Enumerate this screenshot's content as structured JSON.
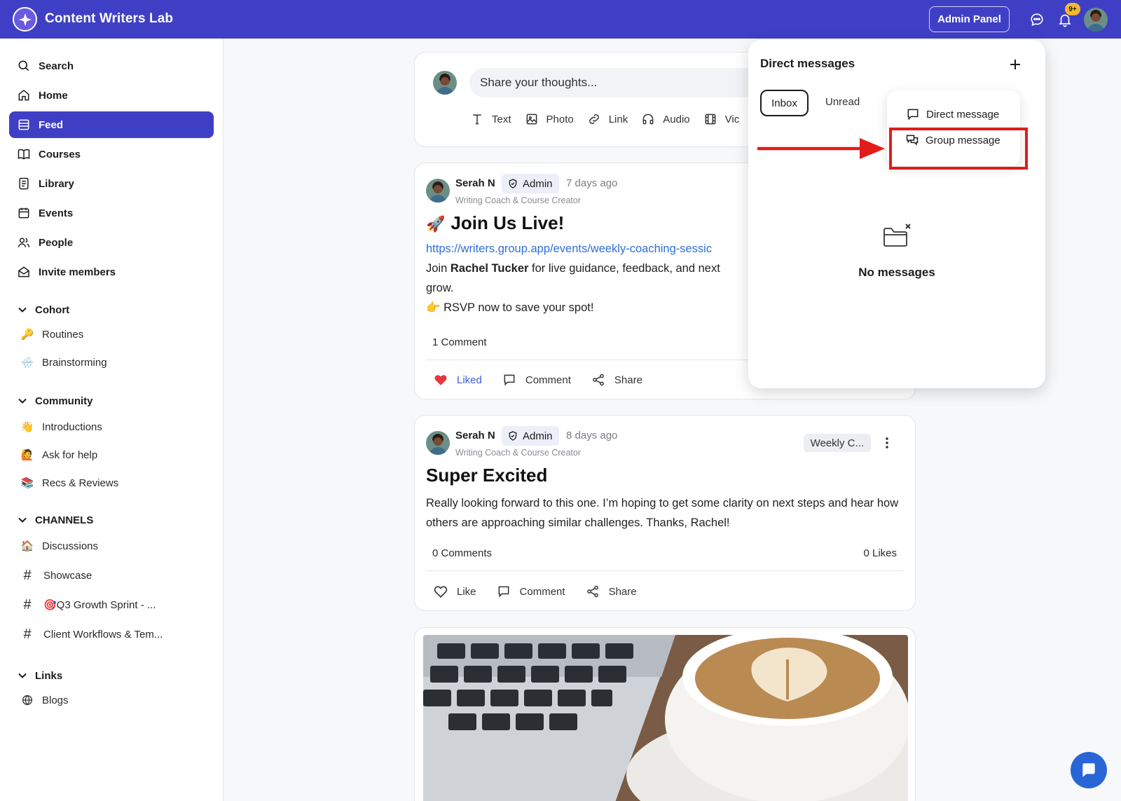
{
  "header": {
    "app_name": "Content Writers Lab",
    "admin_label": "Admin Panel",
    "notification_count": "9+",
    "accent": "#3f3fc6"
  },
  "sidebar": {
    "nav": [
      {
        "label": "Search",
        "icon": "search-icon"
      },
      {
        "label": "Home",
        "icon": "home-icon"
      },
      {
        "label": "Feed",
        "icon": "feed-icon",
        "active": true
      },
      {
        "label": "Courses",
        "icon": "book-icon"
      },
      {
        "label": "Library",
        "icon": "library-icon"
      },
      {
        "label": "Events",
        "icon": "calendar-icon"
      },
      {
        "label": "People",
        "icon": "people-icon"
      },
      {
        "label": "Invite members",
        "icon": "envelope-icon"
      }
    ],
    "sections": {
      "cohort": {
        "title": "Cohort",
        "items": [
          {
            "emoji": "🔑",
            "label": "Routines"
          },
          {
            "emoji": "🌧️",
            "label": "Brainstorming"
          }
        ]
      },
      "community": {
        "title": "Community",
        "items": [
          {
            "emoji": "👋",
            "label": "Introductions"
          },
          {
            "emoji": "🙋",
            "label": "Ask for help"
          },
          {
            "emoji": "📚",
            "label": "Recs & Reviews"
          }
        ]
      },
      "channels": {
        "title": "CHANNELS",
        "items": [
          {
            "emoji": "🏠",
            "label": "Discussions"
          },
          {
            "label": "Showcase"
          },
          {
            "label": "🎯Q3 Growth Sprint - ..."
          },
          {
            "label": "Client Workflows & Tem..."
          }
        ]
      },
      "links": {
        "title": "Links",
        "items": [
          {
            "label": "Blogs",
            "icon": "globe-icon"
          }
        ]
      }
    }
  },
  "composer": {
    "placeholder": "Share your thoughts...",
    "tools": [
      "Text",
      "Photo",
      "Link",
      "Audio",
      "Vic"
    ]
  },
  "posts": [
    {
      "author": "Serah N",
      "role": "Admin",
      "time": "7 days ago",
      "subtitle": "Writing Coach & Course Creator",
      "title_emoji": "🚀",
      "title": "Join Us Live!",
      "link": "https://writers.group.app/events/weekly-coaching-sessic",
      "body_pre": "Join ",
      "body_bold": "Rachel Tucker",
      "body_post": " for live guidance, feedback, and next",
      "body_line2": "grow.",
      "body_line3": "👉 RSVP now to save your spot!",
      "comments": "1 Comment",
      "like_label": "Liked",
      "comment_label": "Comment",
      "share_label": "Share"
    },
    {
      "author": "Serah N",
      "role": "Admin",
      "time": "8 days ago",
      "subtitle": "Writing Coach & Course Creator",
      "tag": "Weekly C...",
      "title": "Super Excited",
      "body": "Really looking forward to this one. I’m hoping to get some clarity on next steps and hear how others are approaching similar challenges. Thanks, Rachel!",
      "comments": "0 Comments",
      "likes": "0 Likes",
      "like_label": "Like",
      "comment_label": "Comment",
      "share_label": "Share"
    }
  ],
  "dm": {
    "title": "Direct messages",
    "tabs": [
      "Inbox",
      "Unread"
    ],
    "menu": [
      "Direct message",
      "Group message"
    ],
    "empty": "No messages",
    "highlight_color": "#e21b1b"
  }
}
